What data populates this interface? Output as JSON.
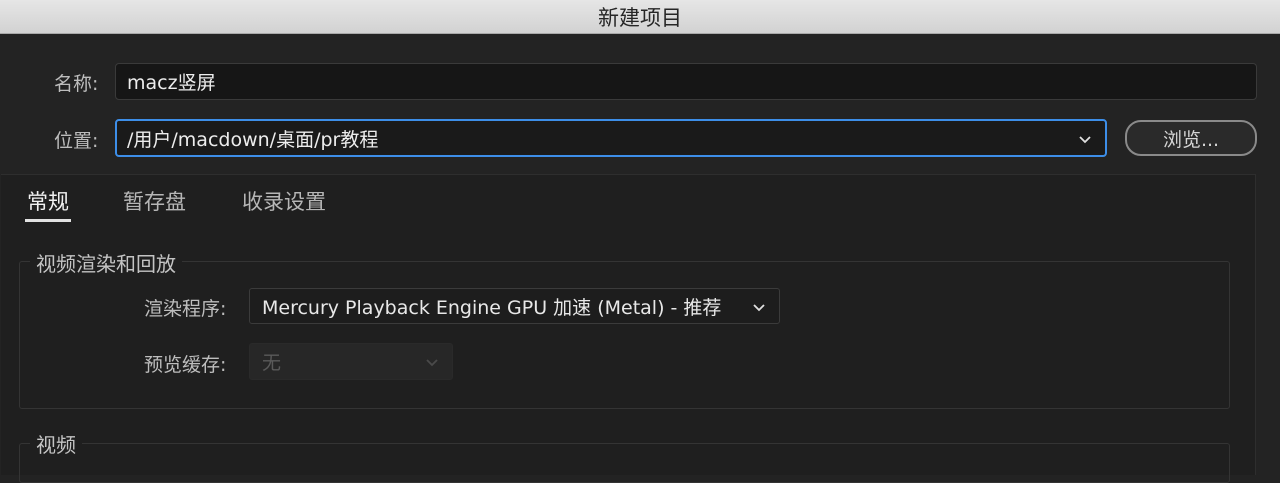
{
  "window": {
    "title": "新建项目"
  },
  "form": {
    "name_label": "名称:",
    "name_value": "macz竖屏",
    "location_label": "位置:",
    "location_value": "/用户/macdown/桌面/pr教程",
    "browse_label": "浏览..."
  },
  "tabs": [
    {
      "label": "常规",
      "active": true
    },
    {
      "label": "暂存盘",
      "active": false
    },
    {
      "label": "收录设置",
      "active": false
    }
  ],
  "video_render_group": {
    "title": "视频渲染和回放",
    "renderer_label": "渲染程序:",
    "renderer_value": "Mercury Playback Engine GPU 加速 (Metal) - 推荐",
    "preview_cache_label": "预览缓存:",
    "preview_cache_value": "无"
  },
  "video_group": {
    "title": "视频"
  },
  "colors": {
    "focus": "#3d8ee8",
    "background": "#232323",
    "titlebar": "#dcdcdc"
  }
}
